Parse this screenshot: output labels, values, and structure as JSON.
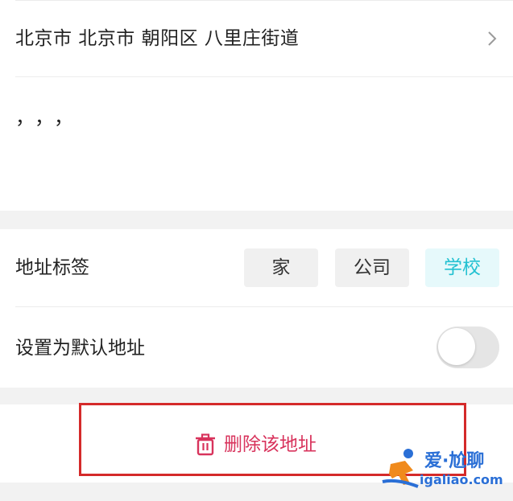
{
  "address": {
    "region": "北京市 北京市 朝阳区 八里庄街道",
    "detail": "，，，"
  },
  "labels": {
    "title": "地址标签",
    "tags": [
      {
        "label": "家",
        "selected": false
      },
      {
        "label": "公司",
        "selected": false
      },
      {
        "label": "学校",
        "selected": true
      }
    ]
  },
  "default_address": {
    "label": "设置为默认地址",
    "enabled": false
  },
  "delete": {
    "label": "删除该地址",
    "icon": "trash-icon"
  },
  "watermark": {
    "name": "爱·尬聊",
    "url": "igaliao.com"
  },
  "colors": {
    "accent": "#22c1d1",
    "delete": "#d8335c",
    "highlight": "#d42a2a",
    "watermark": "#2a6fd6"
  }
}
